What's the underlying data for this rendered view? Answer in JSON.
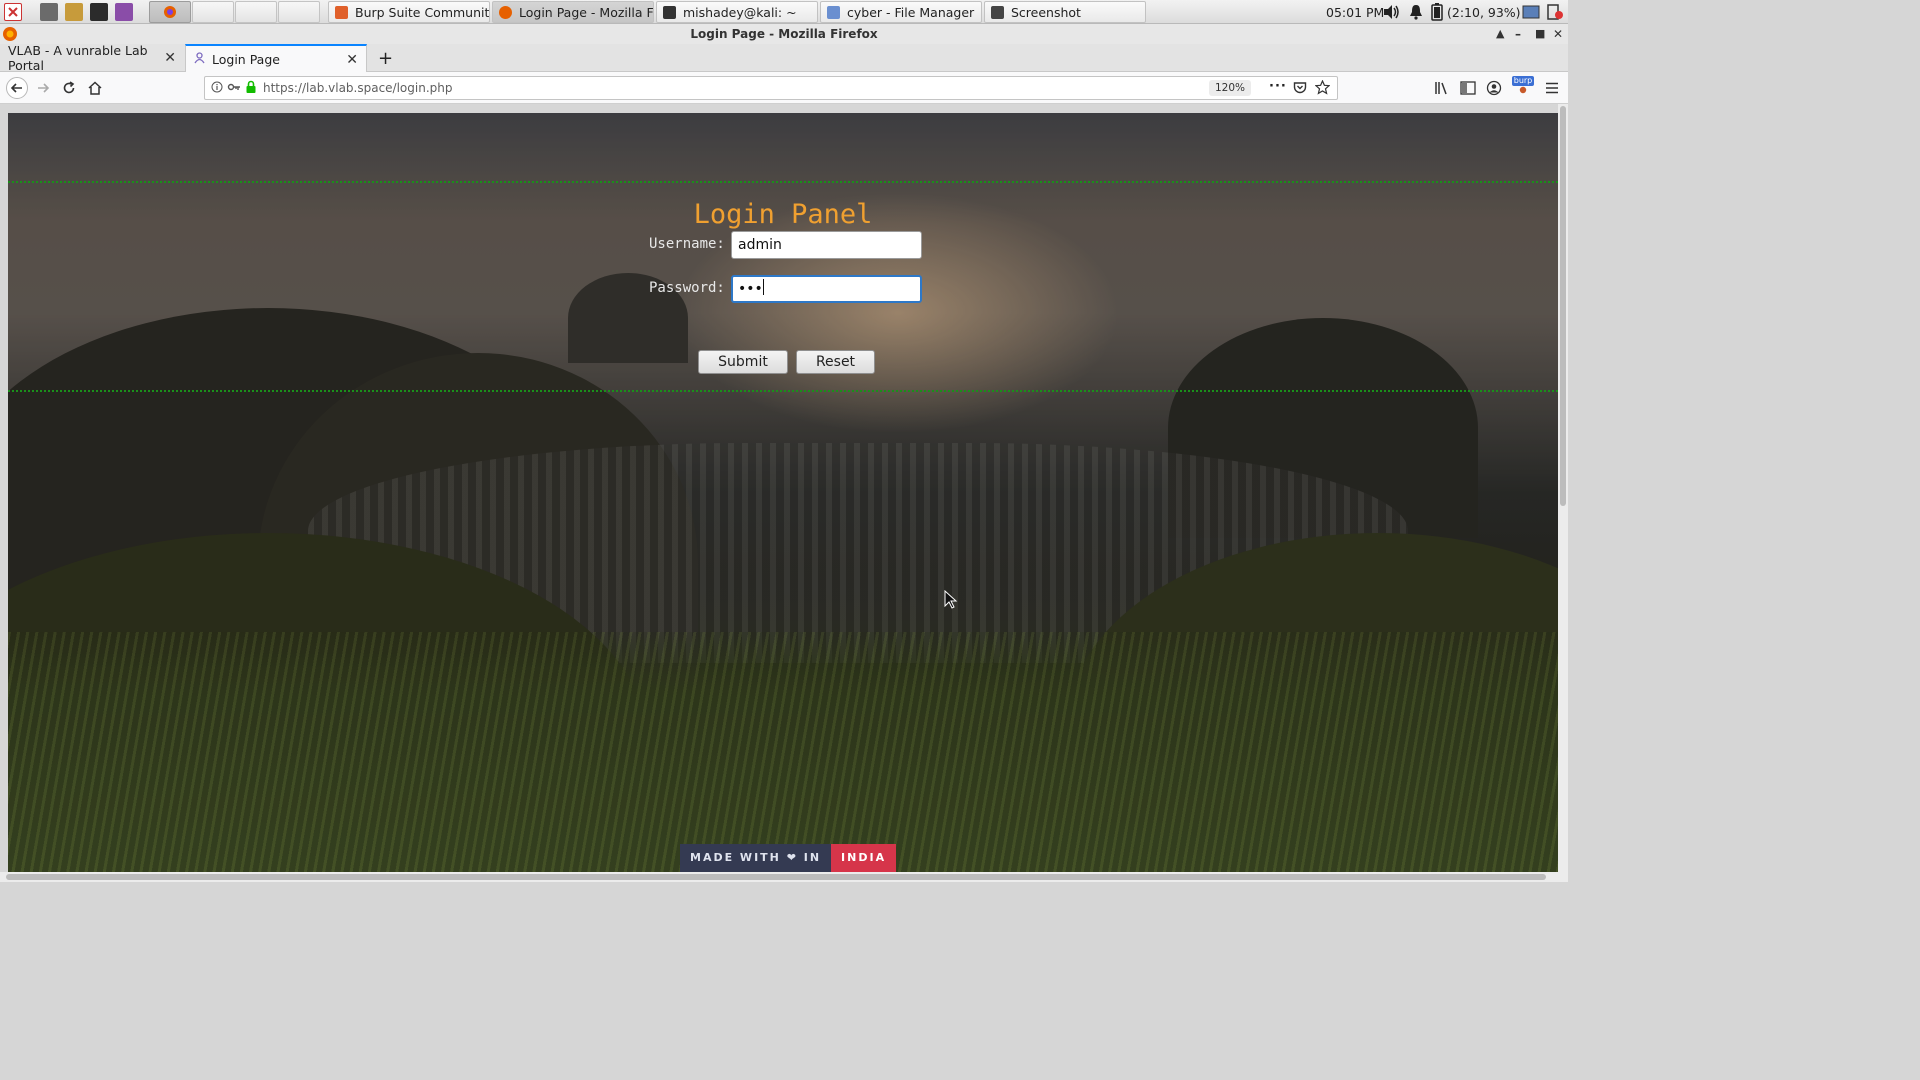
{
  "taskbar": {
    "tasks": [
      {
        "label": "Burp Suite Community ...",
        "icon": "burp-icon",
        "color": "#e0602a"
      },
      {
        "label": "Login Page - Mozilla Fir...",
        "icon": "firefox-icon",
        "color": "#e66000"
      },
      {
        "label": "mishadey@kali: ~",
        "icon": "terminal-icon",
        "color": "#333333"
      },
      {
        "label": "cyber - File Manager",
        "icon": "folder-icon",
        "color": "#6a8fd0"
      },
      {
        "label": "Screenshot",
        "icon": "camera-icon",
        "color": "#444444"
      }
    ],
    "clock": "05:01 PM",
    "battery": "(2:10, 93%)"
  },
  "window": {
    "title": "Login Page - Mozilla Firefox"
  },
  "browser": {
    "tabs": [
      {
        "label": "VLAB - A vunrable Lab Portal",
        "selected": false
      },
      {
        "label": "Login Page",
        "selected": true
      }
    ],
    "new_tab_label": "+",
    "url": "https://lab.vlab.space/login.php",
    "zoom": "120%",
    "extension_badge": "burp"
  },
  "page": {
    "title": "Login Panel",
    "username_label": "Username:",
    "username_value": "admin",
    "password_label": "Password:",
    "password_value": "•••",
    "submit_label": "Submit",
    "reset_label": "Reset",
    "badge_left": "MADE WITH ❤ IN",
    "badge_right": "INDIA"
  },
  "colors": {
    "title_accent": "#f0a030",
    "dotted_border": "#1a8f1a",
    "badge_dark": "#343a52",
    "badge_red": "#d6354a",
    "focus_ring": "#2d78c8"
  }
}
